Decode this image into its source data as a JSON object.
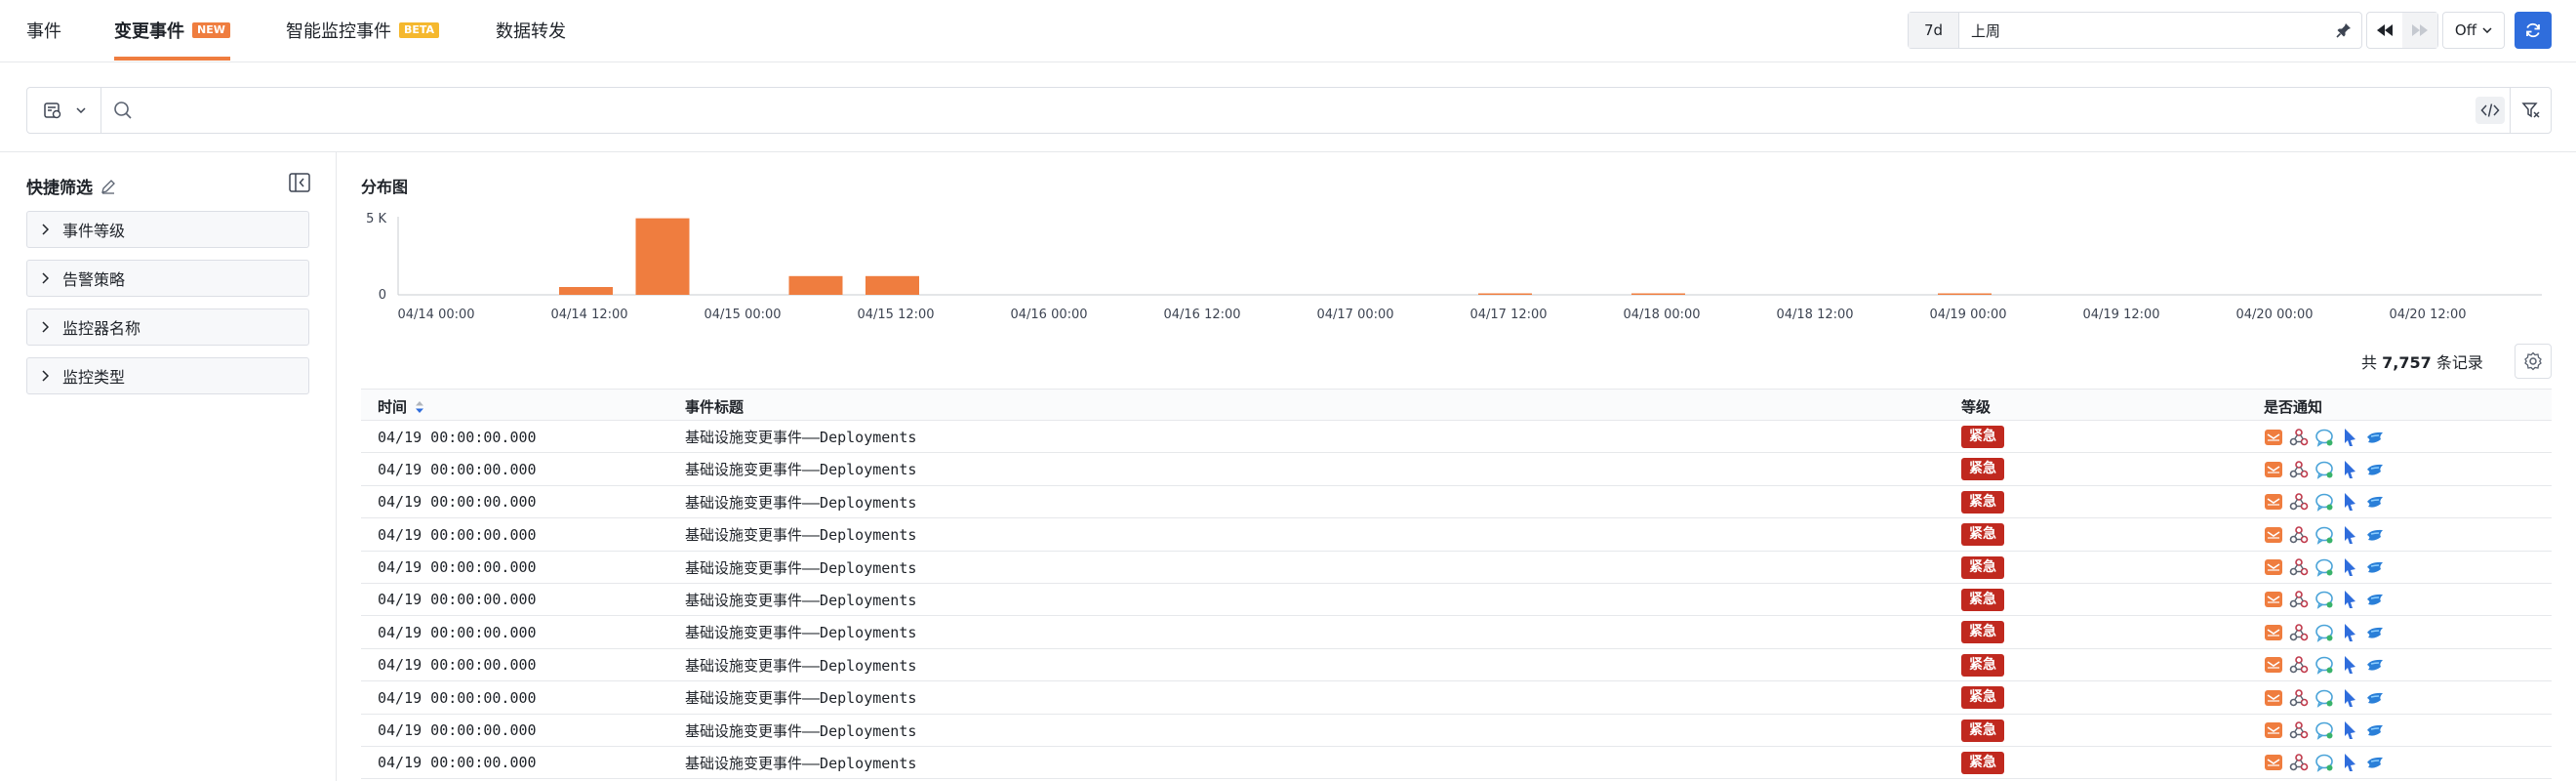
{
  "tabs": [
    {
      "label": "事件",
      "badge": ""
    },
    {
      "label": "变更事件",
      "badge": "NEW"
    },
    {
      "label": "智能监控事件",
      "badge": "BETA"
    },
    {
      "label": "数据转发",
      "badge": ""
    }
  ],
  "time": {
    "quick": "7d",
    "range": "上周",
    "refresh_mode": "Off"
  },
  "search": {
    "placeholder": ""
  },
  "quick_filter": {
    "title": "快捷筛选",
    "items": [
      "事件等级",
      "告警策略",
      "监控器名称",
      "监控类型"
    ]
  },
  "chart": {
    "title": "分布图"
  },
  "chart_data": {
    "type": "bar",
    "title": "分布图",
    "x": [
      "04/14 00:00",
      "04/14 06:00",
      "04/14 12:00",
      "04/14 18:00",
      "04/15 00:00",
      "04/15 06:00",
      "04/15 12:00",
      "04/15 18:00",
      "04/16 00:00",
      "04/16 06:00",
      "04/16 12:00",
      "04/16 18:00",
      "04/17 00:00",
      "04/17 06:00",
      "04/17 12:00",
      "04/17 18:00",
      "04/18 00:00",
      "04/18 06:00",
      "04/18 12:00",
      "04/18 18:00",
      "04/19 00:00",
      "04/19 06:00",
      "04/19 12:00",
      "04/19 18:00",
      "04/20 00:00",
      "04/20 06:00",
      "04/20 12:00",
      "04/20 18:00"
    ],
    "values": [
      0,
      0,
      500,
      4900,
      0,
      1200,
      1200,
      0,
      0,
      0,
      0,
      0,
      0,
      0,
      30,
      0,
      20,
      0,
      0,
      0,
      10,
      0,
      0,
      0,
      0,
      0,
      0,
      0
    ],
    "xticks": [
      "04/14 00:00",
      "04/14 12:00",
      "04/15 00:00",
      "04/15 12:00",
      "04/16 00:00",
      "04/16 12:00",
      "04/17 00:00",
      "04/17 12:00",
      "04/18 00:00",
      "04/18 12:00",
      "04/19 00:00",
      "04/19 12:00",
      "04/20 00:00",
      "04/20 12:00"
    ],
    "yticks": [
      "5 K",
      "0"
    ],
    "ylim": [
      0,
      5000
    ],
    "color": "#ef7d3f",
    "grid": false
  },
  "table": {
    "total_prefix": "共",
    "total_count": "7,757",
    "total_suffix": "条记录",
    "headers": {
      "time": "时间",
      "title": "事件标题",
      "level": "等级",
      "notify": "是否通知"
    },
    "rows": [
      {
        "time": "04/19 00:00:00.000",
        "title": "基础设施变更事件––Deployments",
        "level": "紧急"
      },
      {
        "time": "04/19 00:00:00.000",
        "title": "基础设施变更事件––Deployments",
        "level": "紧急"
      },
      {
        "time": "04/19 00:00:00.000",
        "title": "基础设施变更事件––Deployments",
        "level": "紧急"
      },
      {
        "time": "04/19 00:00:00.000",
        "title": "基础设施变更事件––Deployments",
        "level": "紧急"
      },
      {
        "time": "04/19 00:00:00.000",
        "title": "基础设施变更事件––Deployments",
        "level": "紧急"
      },
      {
        "time": "04/19 00:00:00.000",
        "title": "基础设施变更事件––Deployments",
        "level": "紧急"
      },
      {
        "time": "04/19 00:00:00.000",
        "title": "基础设施变更事件––Deployments",
        "level": "紧急"
      },
      {
        "time": "04/19 00:00:00.000",
        "title": "基础设施变更事件––Deployments",
        "level": "紧急"
      },
      {
        "time": "04/19 00:00:00.000",
        "title": "基础设施变更事件––Deployments",
        "level": "紧急"
      },
      {
        "time": "04/19 00:00:00.000",
        "title": "基础设施变更事件––Deployments",
        "level": "紧急"
      },
      {
        "time": "04/19 00:00:00.000",
        "title": "基础设施变更事件––Deployments",
        "level": "紧急"
      }
    ],
    "notify_icons": [
      "email-icon",
      "webhook-icon",
      "chat-icon",
      "lark-icon",
      "dingtalk-icon"
    ]
  },
  "colors": {
    "accent": "#ef7d3f",
    "primary": "#2f6ddc",
    "critical": "#c0291f"
  }
}
